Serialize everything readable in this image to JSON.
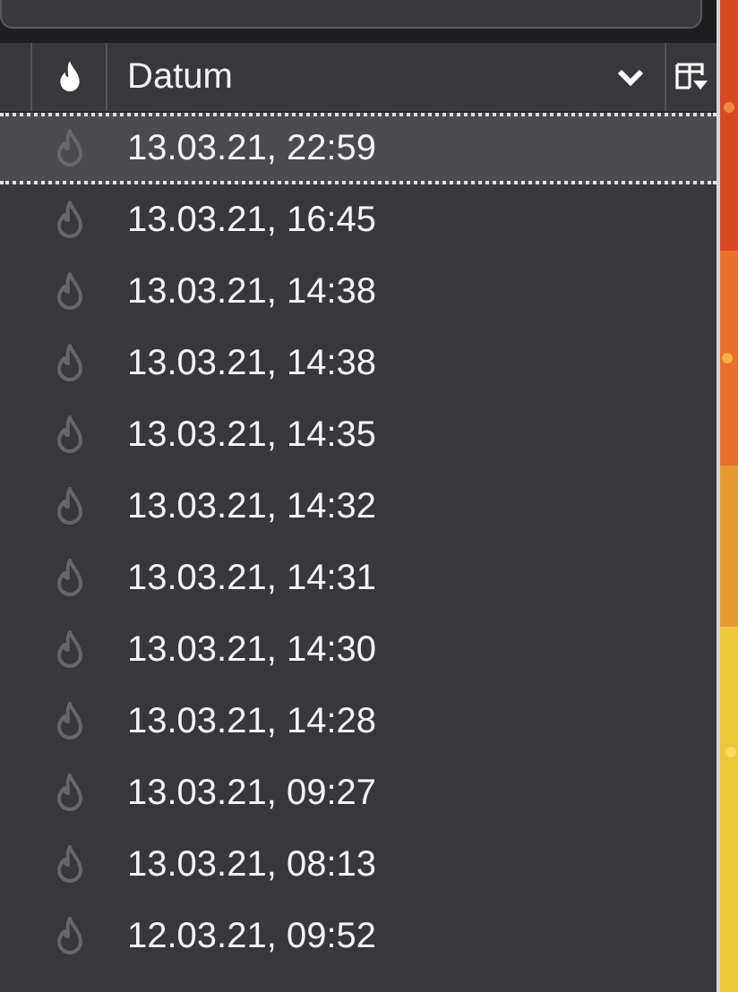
{
  "search": {
    "kind": "field"
  },
  "table": {
    "columns": [
      {
        "kind": "blank"
      },
      {
        "kind": "flame"
      },
      {
        "kind": "text",
        "label": "Datum",
        "sorted": true
      },
      {
        "kind": "chooser"
      }
    ],
    "rows": [
      {
        "date": "13.03.21, 22:59",
        "selected": true
      },
      {
        "date": "13.03.21, 16:45",
        "selected": false
      },
      {
        "date": "13.03.21, 14:38",
        "selected": false
      },
      {
        "date": "13.03.21, 14:38",
        "selected": false
      },
      {
        "date": "13.03.21, 14:35",
        "selected": false
      },
      {
        "date": "13.03.21, 14:32",
        "selected": false
      },
      {
        "date": "13.03.21, 14:31",
        "selected": false
      },
      {
        "date": "13.03.21, 14:30",
        "selected": false
      },
      {
        "date": "13.03.21, 14:28",
        "selected": false
      },
      {
        "date": "13.03.21, 09:27",
        "selected": false
      },
      {
        "date": "13.03.21, 08:13",
        "selected": false
      },
      {
        "date": "12.03.21, 09:52",
        "selected": false
      }
    ]
  }
}
